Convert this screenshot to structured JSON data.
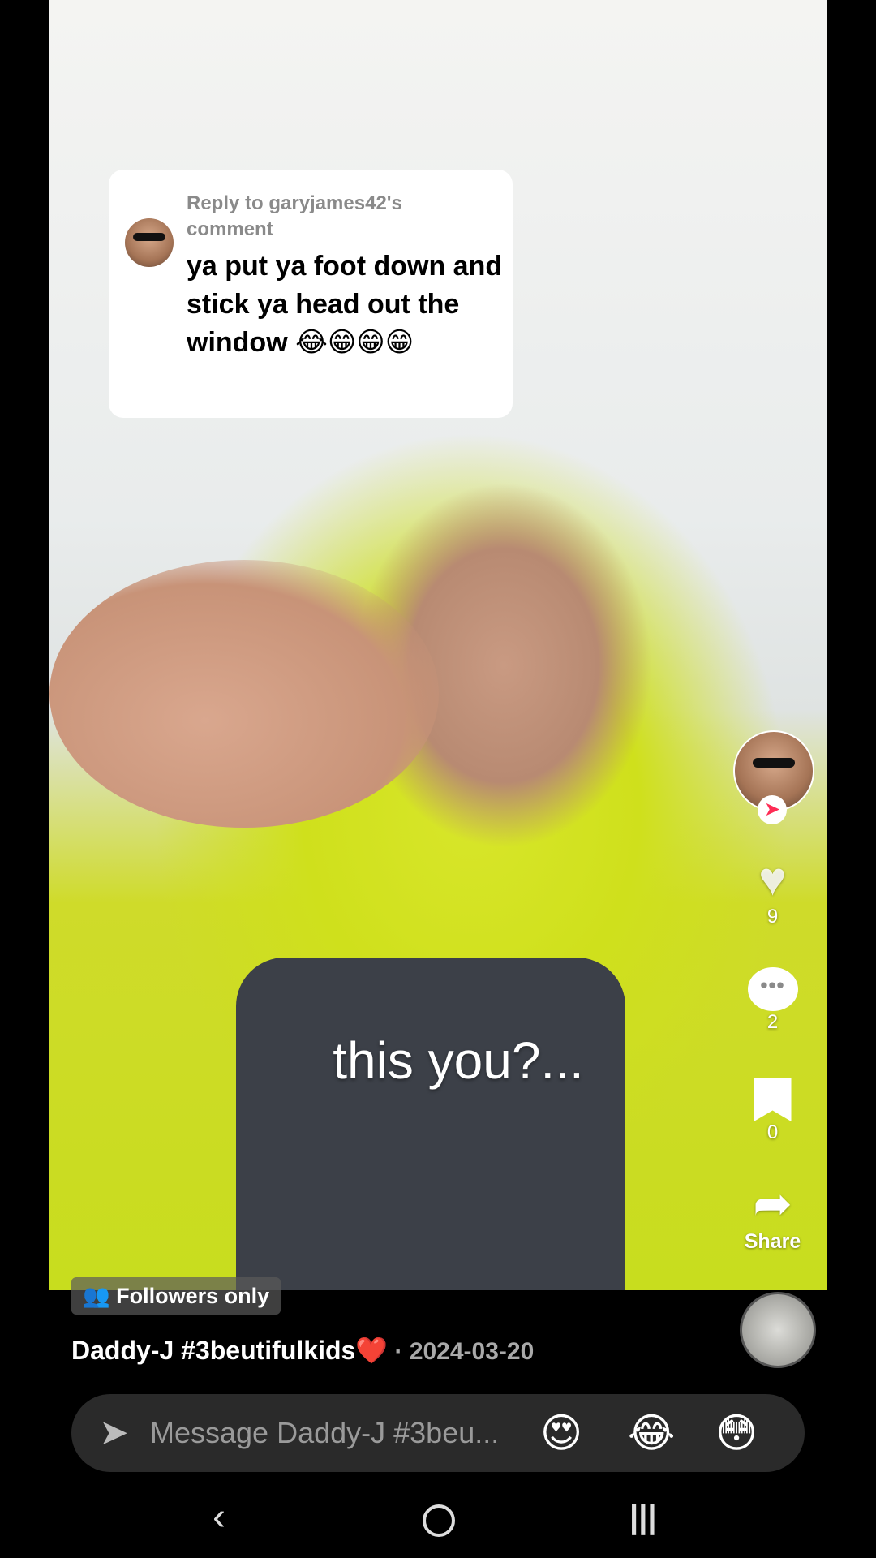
{
  "video": {
    "caption": "this you?..."
  },
  "reply_card": {
    "label": "Reply to garyjames42's comment",
    "text": "ya put ya foot down and stick ya head out the window 😂😁😁😁"
  },
  "rail": {
    "follow_badge": "➤",
    "like_icon": "♥",
    "like_count": "9",
    "comment_icon": "•••",
    "comment_count": "2",
    "bookmark_count": "0",
    "share_icon": "➦",
    "share_label": "Share"
  },
  "post": {
    "visibility": "Followers only",
    "author": "Daddy-J #3beutifulkids❤️",
    "date_sep": " · ",
    "date": "2024-03-20"
  },
  "message": {
    "send_icon": "➤",
    "placeholder": "Message Daddy-J #3beu...",
    "emojis": [
      "😍",
      "😂",
      "😳"
    ]
  },
  "nav": {
    "back": "‹",
    "recent": "|||"
  }
}
